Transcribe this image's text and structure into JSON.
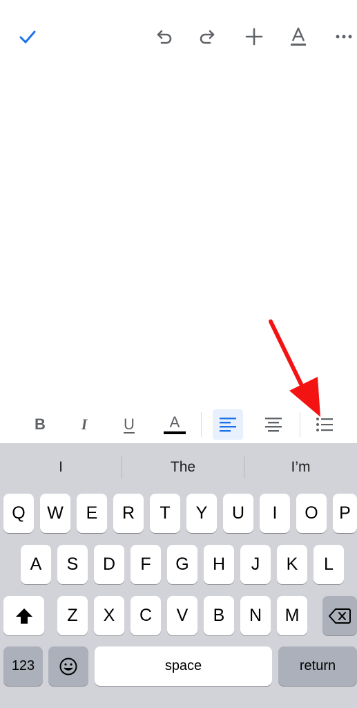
{
  "toolbar": {
    "done_icon": "checkmark-icon",
    "undo_icon": "undo-icon",
    "redo_icon": "redo-icon",
    "insert_icon": "plus-icon",
    "format_icon": "text-format-icon",
    "more_icon": "more-icon",
    "accent_color": "#1a73e8",
    "icon_color": "#5f6368"
  },
  "format_bar": {
    "bold_label": "B",
    "italic_label": "I",
    "underline_label": "U",
    "text_color_label": "A",
    "align_left_icon": "align-left-icon",
    "align_center_icon": "align-center-icon",
    "bullet_list_icon": "bulleted-list-icon",
    "active_bg": "#e8f0fe"
  },
  "keyboard": {
    "suggestions": [
      "I",
      "The",
      "I’m"
    ],
    "row1": [
      "Q",
      "W",
      "E",
      "R",
      "T",
      "Y",
      "U",
      "I",
      "O",
      "P"
    ],
    "row2": [
      "A",
      "S",
      "D",
      "F",
      "G",
      "H",
      "J",
      "K",
      "L"
    ],
    "row3": [
      "Z",
      "X",
      "C",
      "V",
      "B",
      "N",
      "M"
    ],
    "numbers_label": "123",
    "space_label": "space",
    "return_label": "return",
    "shift_icon": "shift-icon",
    "delete_icon": "delete-icon",
    "emoji_icon": "emoji-icon"
  },
  "annotation": {
    "arrow_color": "#f41313"
  }
}
